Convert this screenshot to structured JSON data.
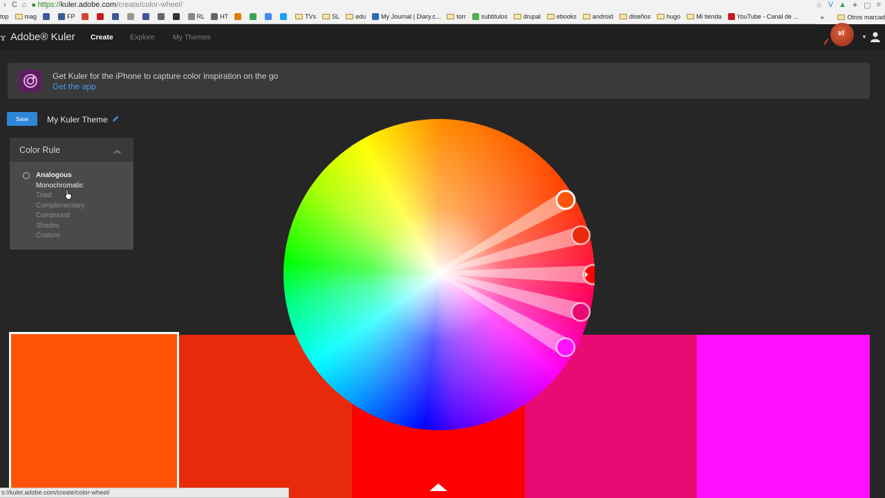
{
  "browser": {
    "url_https": "https://",
    "url_host": "kuler.adobe.com",
    "url_path": "/create/color-wheel/",
    "status_url": "s://kuler.adobe.com/create/color-wheel/",
    "bookmarks": [
      {
        "label": "top",
        "kind": "text",
        "color": "#f2f2f2"
      },
      {
        "label": "mag",
        "kind": "folder",
        "color": "#f5e3a9"
      },
      {
        "label": "",
        "kind": "icon",
        "color": "#3b5998"
      },
      {
        "label": "FP",
        "kind": "icon",
        "color": "#3b5998"
      },
      {
        "label": "",
        "kind": "icon",
        "color": "#d44638"
      },
      {
        "label": "",
        "kind": "icon",
        "color": "#cc181e"
      },
      {
        "label": "",
        "kind": "icon",
        "color": "#3b5998"
      },
      {
        "label": "",
        "kind": "icon",
        "color": "#999999"
      },
      {
        "label": "",
        "kind": "icon",
        "color": "#3b5998"
      },
      {
        "label": "",
        "kind": "icon",
        "color": "#666666"
      },
      {
        "label": "",
        "kind": "icon",
        "color": "#333333"
      },
      {
        "label": "RL",
        "kind": "icon",
        "color": "#888888"
      },
      {
        "label": "HT",
        "kind": "icon",
        "color": "#666666"
      },
      {
        "label": "",
        "kind": "icon",
        "color": "#e07b00"
      },
      {
        "label": "",
        "kind": "icon",
        "color": "#3aa657"
      },
      {
        "label": "",
        "kind": "icon",
        "color": "#4285f4"
      },
      {
        "label": "",
        "kind": "icon",
        "color": "#1da1f2"
      },
      {
        "label": "TVs",
        "kind": "folder",
        "color": "#f5e3a9"
      },
      {
        "label": "SL",
        "kind": "folder",
        "color": "#f5e3a9"
      },
      {
        "label": "edu",
        "kind": "folder",
        "color": "#f5e3a9"
      },
      {
        "label": "My Journal | Diary.c...",
        "kind": "icon",
        "color": "#2d6bb5"
      },
      {
        "label": "torr",
        "kind": "folder",
        "color": "#f5e3a9"
      },
      {
        "label": "subtitulos",
        "kind": "icon",
        "color": "#4caf50"
      },
      {
        "label": "drupal",
        "kind": "folder",
        "color": "#f5e3a9"
      },
      {
        "label": "ebooks",
        "kind": "folder",
        "color": "#f5e3a9"
      },
      {
        "label": "android",
        "kind": "folder",
        "color": "#f5e3a9"
      },
      {
        "label": "diseños",
        "kind": "folder",
        "color": "#f5e3a9"
      },
      {
        "label": "hugo",
        "kind": "folder",
        "color": "#f5e3a9"
      },
      {
        "label": "Mi tienda",
        "kind": "folder",
        "color": "#f5e3a9"
      },
      {
        "label": "YouTube - Canal de ...",
        "kind": "icon",
        "color": "#cc181e"
      }
    ],
    "other_bookmarks": "Otros marcad",
    "overflow": "»"
  },
  "nav": {
    "brand": "Adobe® Kuler",
    "items": [
      {
        "label": "Create",
        "active": true
      },
      {
        "label": "Explore",
        "active": false
      },
      {
        "label": "My Themes",
        "active": false
      }
    ],
    "avatar_initials": "vi"
  },
  "banner": {
    "text": "Get Kuler for the iPhone to capture color inspiration on the go",
    "link": "Get the app"
  },
  "theme": {
    "save_label": "Save",
    "title": "My Kuler Theme"
  },
  "color_rule": {
    "title": "Color Rule",
    "options": [
      "Analogous",
      "Monochromatic",
      "Triad",
      "Complementary",
      "Compound",
      "Shades",
      "Custom"
    ],
    "selected": "Analogous",
    "hovered": "Monochromatic"
  },
  "swatches": [
    {
      "name": "swatch-1",
      "color": "#ff5408",
      "selected": true
    },
    {
      "name": "swatch-2",
      "color": "#e8290a",
      "selected": false
    },
    {
      "name": "swatch-3",
      "color": "#ff0000",
      "selected": false
    },
    {
      "name": "swatch-4",
      "color": "#e90b74",
      "selected": false
    },
    {
      "name": "swatch-5",
      "color": "#ff11ff",
      "selected": false
    }
  ],
  "wheel_handles": [
    {
      "color": "#ff5408",
      "base": false
    },
    {
      "color": "#e8290a",
      "base": false
    },
    {
      "color": "#ff0000",
      "base": true
    },
    {
      "color": "#e90b74",
      "base": false
    },
    {
      "color": "#ff11ff",
      "base": false
    }
  ]
}
